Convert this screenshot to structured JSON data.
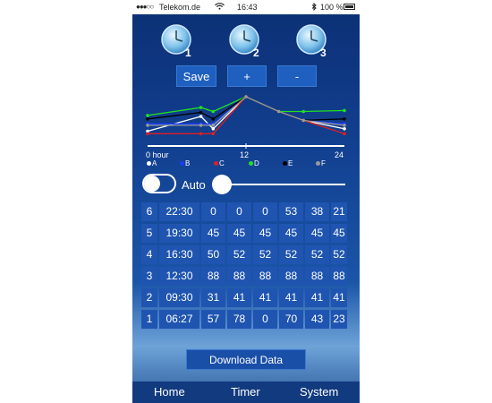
{
  "status": {
    "signal": "●●●○○",
    "carrier": "Telekom.de",
    "time": "16:43",
    "battery": "100 %"
  },
  "presets": [
    {
      "number": "1"
    },
    {
      "number": "2"
    },
    {
      "number": "3"
    }
  ],
  "buttons": {
    "save": "Save",
    "plus": "+",
    "minus": "-"
  },
  "chart_data": {
    "type": "line",
    "x_ticks": [
      "0 hour",
      "12",
      "24"
    ],
    "xlim": [
      0,
      24
    ],
    "legend": [
      "A",
      "B",
      "C",
      "D",
      "E",
      "F"
    ],
    "colors": {
      "A": "#ffffff",
      "B": "#1a3cff",
      "C": "#e01f1f",
      "D": "#22e022",
      "E": "#000000",
      "F": "#9a9a9a"
    },
    "series": [
      {
        "name": "A",
        "points": [
          [
            0,
            30
          ],
          [
            6.5,
            60
          ],
          [
            8,
            35
          ],
          [
            12,
            100
          ],
          [
            16,
            70
          ],
          [
            19,
            52
          ],
          [
            24,
            35
          ]
        ]
      },
      {
        "name": "B",
        "points": [
          [
            0,
            45
          ],
          [
            6.5,
            45
          ],
          [
            8,
            45
          ],
          [
            12,
            100
          ],
          [
            16,
            70
          ],
          [
            19,
            52
          ],
          [
            24,
            45
          ]
        ]
      },
      {
        "name": "C",
        "points": [
          [
            0,
            25
          ],
          [
            6.5,
            25
          ],
          [
            8,
            25
          ],
          [
            12,
            100
          ],
          [
            16,
            70
          ],
          [
            19,
            52
          ],
          [
            24,
            25
          ]
        ]
      },
      {
        "name": "D",
        "points": [
          [
            0,
            62
          ],
          [
            6.5,
            78
          ],
          [
            8,
            70
          ],
          [
            12,
            100
          ],
          [
            16,
            70
          ],
          [
            19,
            70
          ],
          [
            24,
            72
          ]
        ]
      },
      {
        "name": "E",
        "points": [
          [
            0,
            55
          ],
          [
            6.5,
            68
          ],
          [
            8,
            55
          ],
          [
            12,
            100
          ],
          [
            16,
            70
          ],
          [
            19,
            52
          ],
          [
            24,
            55
          ]
        ]
      },
      {
        "name": "F",
        "points": [
          [
            0,
            42
          ],
          [
            6.5,
            42
          ],
          [
            8,
            42
          ],
          [
            12,
            100
          ],
          [
            16,
            70
          ],
          [
            19,
            52
          ],
          [
            24,
            42
          ]
        ]
      }
    ]
  },
  "auto_label": "Auto",
  "table": {
    "rows": [
      {
        "index": "6",
        "time": "22:30",
        "values": [
          "0",
          "0",
          "0",
          "53",
          "38",
          "21"
        ]
      },
      {
        "index": "5",
        "time": "19:30",
        "values": [
          "45",
          "45",
          "45",
          "45",
          "45",
          "45"
        ]
      },
      {
        "index": "4",
        "time": "16:30",
        "values": [
          "50",
          "52",
          "52",
          "52",
          "52",
          "52"
        ]
      },
      {
        "index": "3",
        "time": "12:30",
        "values": [
          "88",
          "88",
          "88",
          "88",
          "88",
          "88"
        ]
      },
      {
        "index": "2",
        "time": "09:30",
        "values": [
          "31",
          "41",
          "41",
          "41",
          "41",
          "41"
        ]
      },
      {
        "index": "1",
        "time": "06:27",
        "values": [
          "57",
          "78",
          "0",
          "70",
          "43",
          "23"
        ]
      }
    ]
  },
  "download_label": "Download Data",
  "tabs": {
    "home": "Home",
    "timer": "Timer",
    "system": "System"
  }
}
